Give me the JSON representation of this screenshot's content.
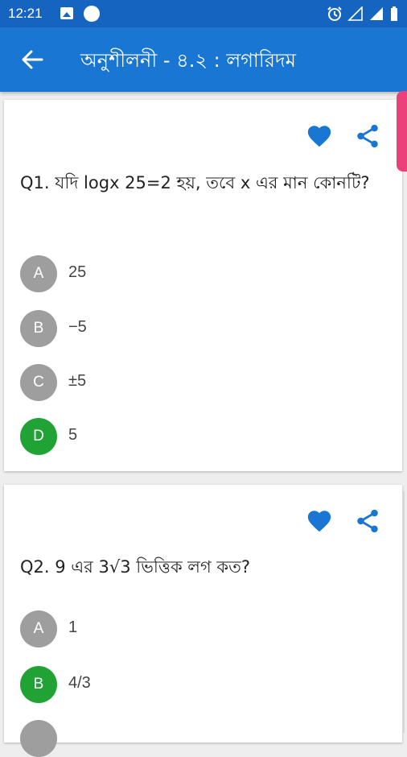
{
  "status_bar": {
    "time": "12:21",
    "icons": [
      "image-icon",
      "circle-icon",
      "alarm-icon",
      "signal-icon",
      "signal-icon",
      "battery-icon"
    ]
  },
  "app_bar": {
    "title": "অনুশীলনী - ৪.২ : লগারিদম",
    "back_icon": "back-arrow-icon"
  },
  "colors": {
    "primary_dark": "#1565c0",
    "primary": "#1976d2",
    "correct": "#20a334",
    "option": "#9e9e9e",
    "accent": "#ec407a"
  },
  "questions": [
    {
      "text": "Q1. যদি logx 25=2 হয়, তবে x এর মান কোনটি?",
      "options": [
        {
          "letter": "A",
          "text": "25"
        },
        {
          "letter": "B",
          "text": "−5"
        },
        {
          "letter": "C",
          "text": "±5"
        },
        {
          "letter": "D",
          "text": "5"
        }
      ],
      "correct_letter": "D"
    },
    {
      "text": "Q2. 9 এর 3√3 ভিত্তিক লগ কত?",
      "options": [
        {
          "letter": "A",
          "text": "1"
        },
        {
          "letter": "B",
          "text": "4/3"
        }
      ],
      "correct_letter": "B"
    }
  ]
}
